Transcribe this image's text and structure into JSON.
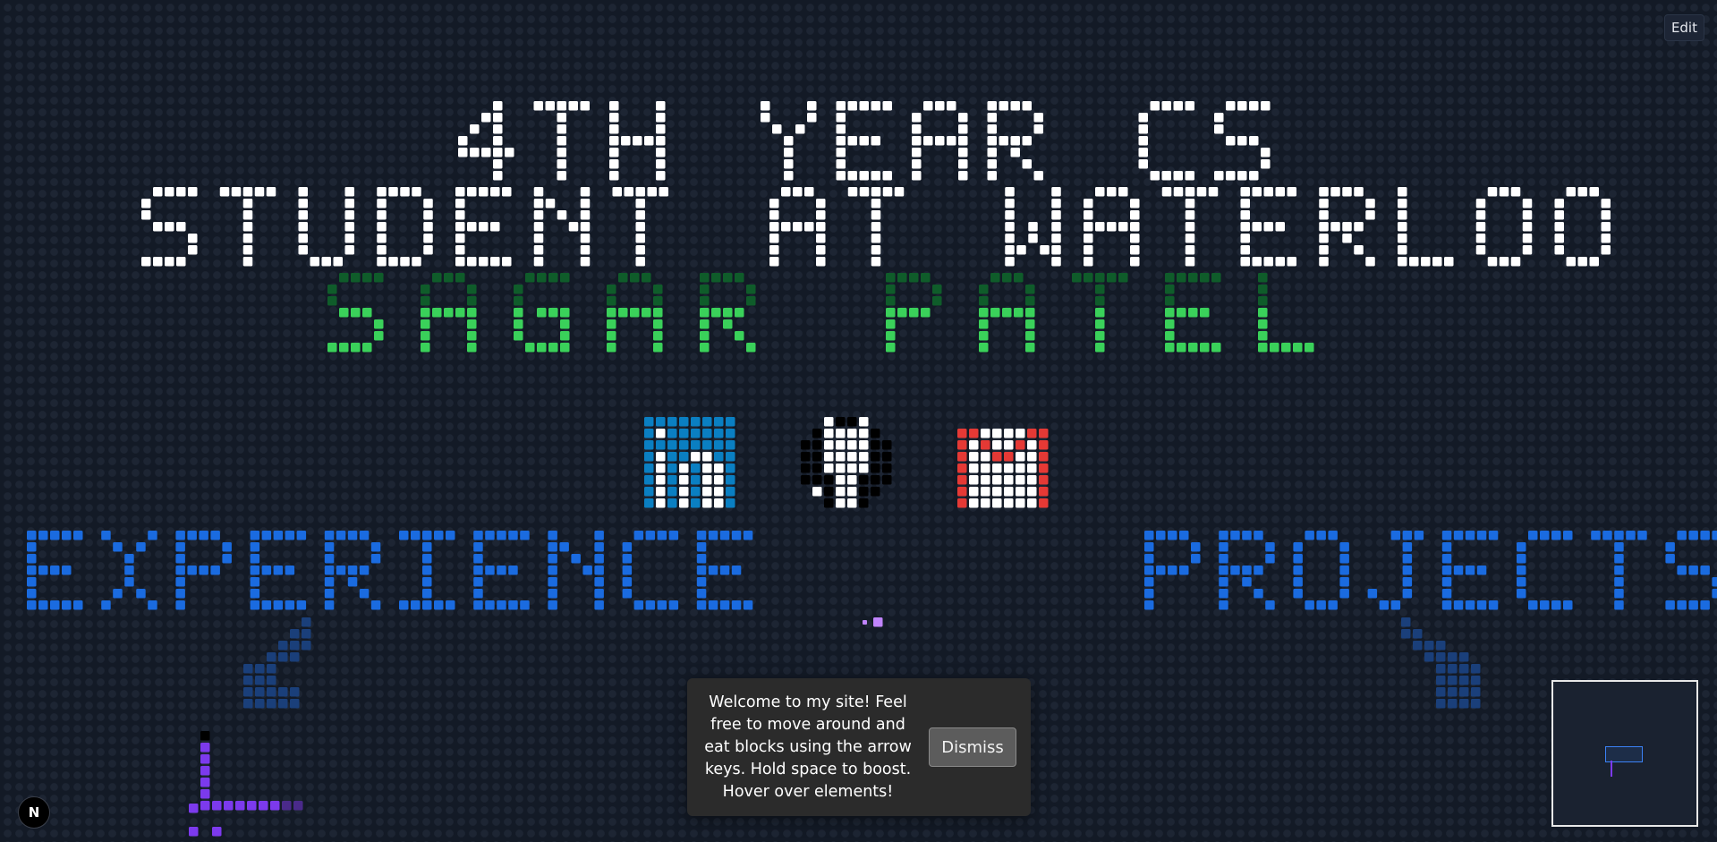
{
  "toolbar": {
    "edit_label": "Edit"
  },
  "hero": {
    "line1": "4TH YEAR CS",
    "line2": "STUDENT AT WATERLOO",
    "name": "SAGAR PATEL"
  },
  "socials": {
    "items": [
      {
        "name": "linkedin",
        "icon": "linkedin-icon",
        "color": "#0a7fc2"
      },
      {
        "name": "github",
        "icon": "github-icon",
        "color": "#000000"
      },
      {
        "name": "gmail",
        "icon": "gmail-icon",
        "color": "#e53935"
      }
    ]
  },
  "sections": {
    "experience": "EXPERIENCE",
    "projects": "PROJECTS"
  },
  "toast": {
    "message": "Welcome to my site! Feel free to move around and eat blocks using the arrow keys. Hold space to boost. Hover over elements!",
    "dismiss_label": "Dismiss"
  },
  "badge": {
    "label": "N"
  },
  "colors": {
    "background": "#131a26",
    "grid_dot": "#1d2533",
    "hero_text": "#ffffff",
    "name_bright": "#3ad15a",
    "name_dark": "#0f5c2a",
    "section_blue": "#1a6be0",
    "arrow_dark_blue": "#1a3f7a",
    "snake_purple": "#7c3aed",
    "food_pink": "#c084fc"
  }
}
